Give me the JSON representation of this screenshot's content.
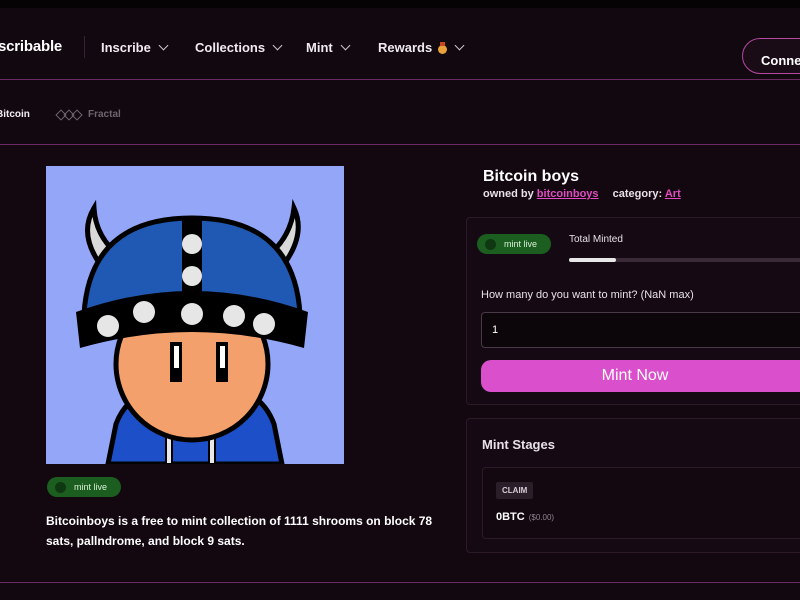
{
  "nav": {
    "logo": "scribable",
    "items": [
      {
        "label": "Inscribe"
      },
      {
        "label": "Collections"
      },
      {
        "label": "Mint"
      },
      {
        "label": "Rewards"
      }
    ],
    "rewards_icon": "medal-icon",
    "connect_label": "Connect"
  },
  "chains": {
    "bitcoin": "Bitcoin",
    "fractal": "Fractal"
  },
  "collection": {
    "title": "Bitcoin boys",
    "owned_by_label": "owned by",
    "owner": "bitcoinboys",
    "category_label": "category:",
    "category": "Art",
    "status": "mint live",
    "description": "Bitcoinboys is a free to mint collection of 1111 shrooms on block 78 sats, pallndrome, and block 9 sats."
  },
  "mint": {
    "status": "mint live",
    "total_minted_label": "Total Minted",
    "minted_fraction": 0.19,
    "quantity_label": "How many do you want to mint? (NaN max)",
    "quantity_value": "1",
    "button_label": "Mint Now"
  },
  "stages": {
    "title": "Mint Stages",
    "items": [
      {
        "tag": "CLAIM",
        "price": "0BTC",
        "usd": "($0.00)"
      }
    ]
  },
  "colors": {
    "accent": "#d94fcc",
    "link": "#e04cc1",
    "live_badge": "#1b5e1f",
    "nft_background": "#93a6f7"
  }
}
